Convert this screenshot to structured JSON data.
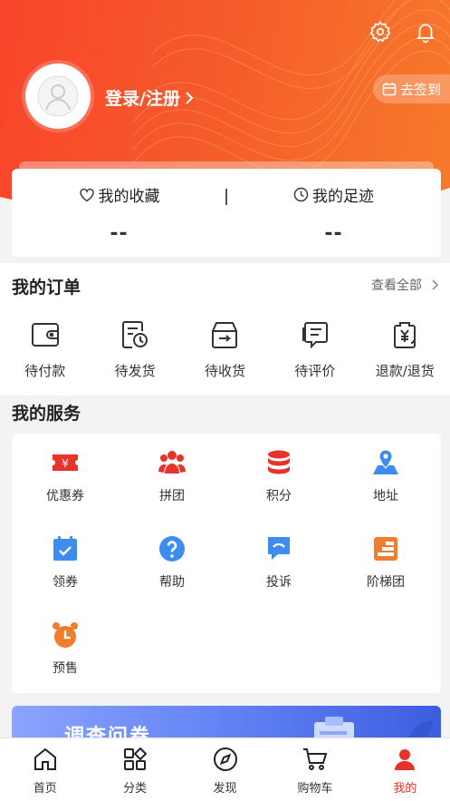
{
  "header": {
    "login_label": "登录/注册",
    "signin_label": "去签到"
  },
  "favorites": {
    "items": [
      {
        "label": "我的收藏",
        "value": "--"
      },
      {
        "label": "我的足迹",
        "value": "--"
      }
    ]
  },
  "orders": {
    "title": "我的订单",
    "view_all": "查看全部",
    "items": [
      {
        "label": "待付款",
        "icon": "wallet-icon"
      },
      {
        "label": "待发货",
        "icon": "doc-clock-icon"
      },
      {
        "label": "待收货",
        "icon": "box-icon"
      },
      {
        "label": "待评价",
        "icon": "comment-icon"
      },
      {
        "label": "退款/退货",
        "icon": "refund-icon"
      }
    ]
  },
  "services": {
    "title": "我的服务",
    "items": [
      {
        "label": "优惠券",
        "icon": "coupon-icon"
      },
      {
        "label": "拼团",
        "icon": "group-icon"
      },
      {
        "label": "积分",
        "icon": "points-icon"
      },
      {
        "label": "地址",
        "icon": "map-icon"
      },
      {
        "label": "领券",
        "icon": "calendar-check-icon"
      },
      {
        "label": "帮助",
        "icon": "help-icon"
      },
      {
        "label": "投诉",
        "icon": "complaint-icon"
      },
      {
        "label": "阶梯团",
        "icon": "ladder-icon"
      },
      {
        "label": "预售",
        "icon": "alarm-icon"
      }
    ]
  },
  "banner": {
    "title": "调查问卷"
  },
  "tabbar": {
    "items": [
      {
        "label": "首页",
        "icon": "home-icon"
      },
      {
        "label": "分类",
        "icon": "category-icon"
      },
      {
        "label": "发现",
        "icon": "compass-icon"
      },
      {
        "label": "购物车",
        "icon": "cart-icon"
      },
      {
        "label": "我的",
        "icon": "user-icon",
        "active": true
      }
    ]
  },
  "colors": {
    "accent": "#e8332a",
    "hero": "#f9442b",
    "blue": "#3f8cf0"
  }
}
